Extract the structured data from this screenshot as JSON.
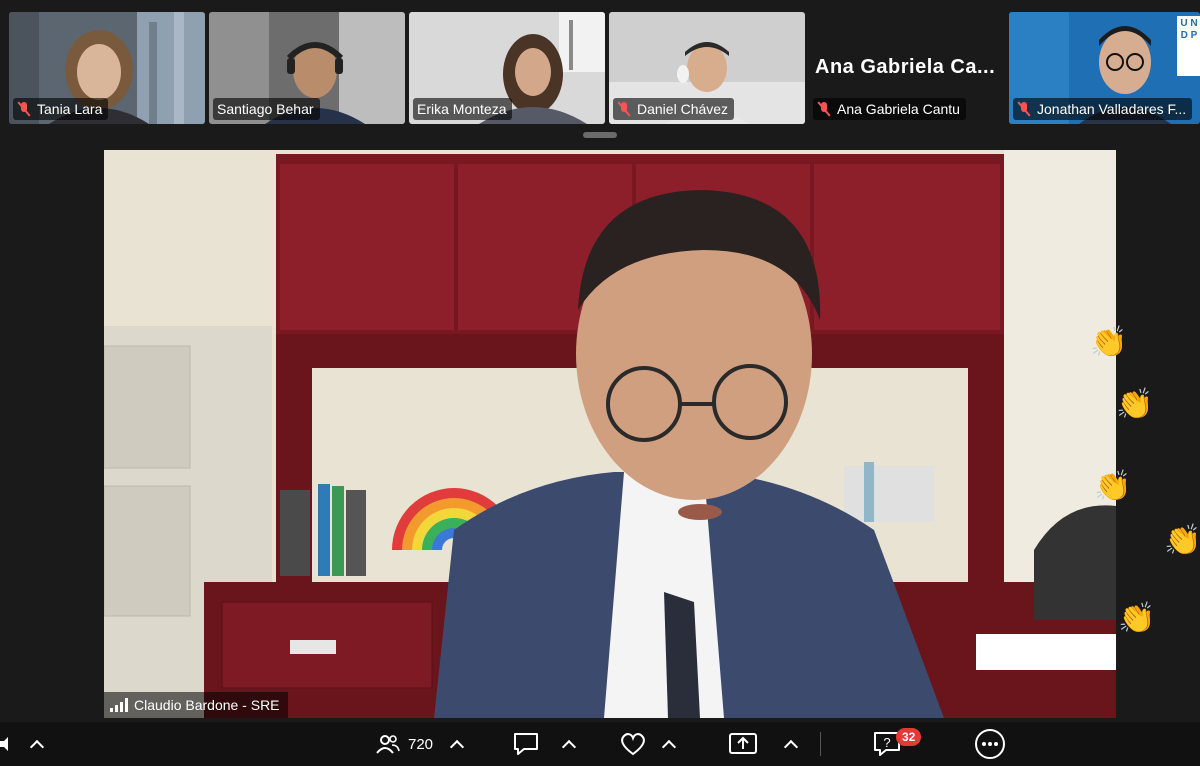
{
  "participants": [
    {
      "name": "Tania Lara",
      "muted": true
    },
    {
      "name": "Santiago Behar",
      "muted": false
    },
    {
      "name": "Erika Monteza",
      "muted": false
    },
    {
      "name": "Daniel Chávez",
      "muted": true
    },
    {
      "name": "Ana Gabriela Cantu",
      "display_name": "Ana Gabriela Ca...",
      "muted": true
    },
    {
      "name": "Jonathan Valladares F...",
      "muted": true
    }
  ],
  "logo_text": "UNDP",
  "active_speaker": {
    "name": "Claudio Bardone - SRE"
  },
  "reactions": [
    "clap",
    "clap",
    "clap",
    "clap",
    "clap"
  ],
  "toolbar": {
    "participants_count": "720",
    "qa_badge": "32"
  },
  "colors": {
    "background": "#1a1a1a",
    "toolbar": "#111111",
    "muted_mic": "#ff5252",
    "badge": "#e53935",
    "reaction": "#f0b830"
  }
}
